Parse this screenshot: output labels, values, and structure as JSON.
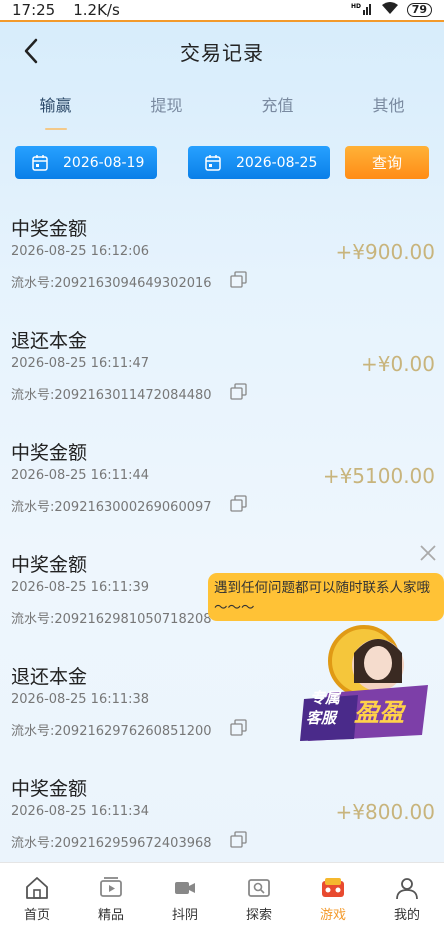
{
  "status": {
    "time": "17:25",
    "speed": "1.2K/s",
    "signal": "HD",
    "battery": "79"
  },
  "header": {
    "title": "交易记录"
  },
  "tabs": [
    {
      "label": "输赢",
      "active": true
    },
    {
      "label": "提现",
      "active": false
    },
    {
      "label": "充值",
      "active": false
    },
    {
      "label": "其他",
      "active": false
    }
  ],
  "filters": {
    "start_date": "2026-08-19",
    "end_date": "2026-08-25",
    "query_label": "查询"
  },
  "records": [
    {
      "title": "中奖金额",
      "time": "2026-08-25 16:12:06",
      "serial": "流水号:2092163094649302016",
      "amount": "+¥900.00"
    },
    {
      "title": "退还本金",
      "time": "2026-08-25 16:11:47",
      "serial": "流水号:2092163011472084480",
      "amount": "+¥0.00"
    },
    {
      "title": "中奖金额",
      "time": "2026-08-25 16:11:44",
      "serial": "流水号:2092163000269060097",
      "amount": "+¥5100.00"
    },
    {
      "title": "中奖金额",
      "time": "2026-08-25 16:11:39",
      "serial": "流水号:2092162981050718208",
      "amount": ""
    },
    {
      "title": "退还本金",
      "time": "2026-08-25 16:11:38",
      "serial": "流水号:2092162976260851200",
      "amount": ""
    },
    {
      "title": "中奖金额",
      "time": "2026-08-25 16:11:34",
      "serial": "流水号:2092162959672403968",
      "amount": "+¥800.00"
    }
  ],
  "popup": {
    "message": "遇到任何问题都可以随时联系人家哦～～～",
    "line1": "专属",
    "line2": "客服",
    "name": "盈盈"
  },
  "bottom_nav": [
    {
      "label": "首页",
      "icon": "home-icon",
      "active": false
    },
    {
      "label": "精品",
      "icon": "video-list-icon",
      "active": false
    },
    {
      "label": "抖阴",
      "icon": "video-camera-icon",
      "active": false
    },
    {
      "label": "探索",
      "icon": "explore-icon",
      "active": false
    },
    {
      "label": "游戏",
      "icon": "game-icon",
      "active": true
    },
    {
      "label": "我的",
      "icon": "profile-icon",
      "active": false
    }
  ],
  "colors": {
    "accent": "#f39a2b",
    "date_button": "#0a7fe8",
    "query_button": "#ff8c16",
    "amount": "#c8b47c"
  }
}
